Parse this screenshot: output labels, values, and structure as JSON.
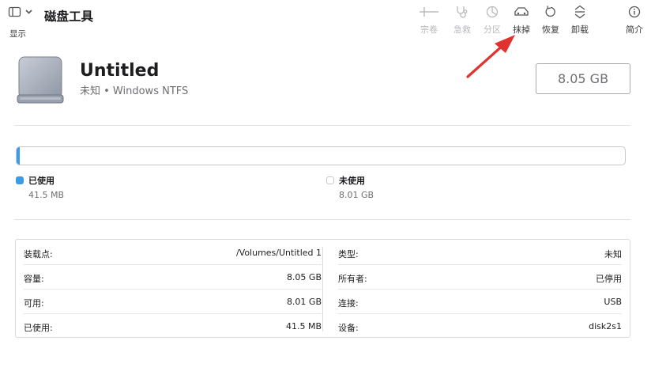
{
  "toolbar": {
    "view_label": "显示",
    "app_title": "磁盘工具",
    "tools": [
      {
        "id": "add",
        "label": "宗卷",
        "icon": "plus-icon",
        "enabled": false
      },
      {
        "id": "remove",
        "label": "",
        "icon": "minus-icon",
        "enabled": false
      },
      {
        "id": "firstaid",
        "label": "急救",
        "icon": "stethoscope-icon",
        "enabled": false
      },
      {
        "id": "partition",
        "label": "分区",
        "icon": "pie-chart-icon",
        "enabled": false
      },
      {
        "id": "erase",
        "label": "抹掉",
        "icon": "erase-icon",
        "enabled": true
      },
      {
        "id": "restore",
        "label": "恢复",
        "icon": "restore-icon",
        "enabled": true
      },
      {
        "id": "unmount",
        "label": "卸载",
        "icon": "eject-icon",
        "enabled": true
      },
      {
        "id": "info",
        "label": "简介",
        "icon": "info-icon",
        "enabled": true
      }
    ]
  },
  "volume": {
    "name": "Untitled",
    "subtitle": "未知 • Windows NTFS",
    "size": "8.05 GB"
  },
  "usage": {
    "used_fraction": 0.005,
    "used_color": "#3a9be6",
    "used_label": "已使用",
    "used_amount": "41.5 MB",
    "free_label": "未使用",
    "free_amount": "8.01 GB"
  },
  "info": {
    "left": [
      {
        "key": "装载点:",
        "value": "/Volumes/Untitled 1"
      },
      {
        "key": "容量:",
        "value": "8.05 GB"
      },
      {
        "key": "可用:",
        "value": "8.01 GB"
      },
      {
        "key": "已使用:",
        "value": "41.5 MB"
      }
    ],
    "right": [
      {
        "key": "类型:",
        "value": "未知"
      },
      {
        "key": "所有者:",
        "value": "已停用"
      },
      {
        "key": "连接:",
        "value": "USB"
      },
      {
        "key": "设备:",
        "value": "disk2s1"
      }
    ]
  },
  "colors": {
    "accent": "#3a9be6",
    "annotation_arrow": "#e0322f"
  }
}
